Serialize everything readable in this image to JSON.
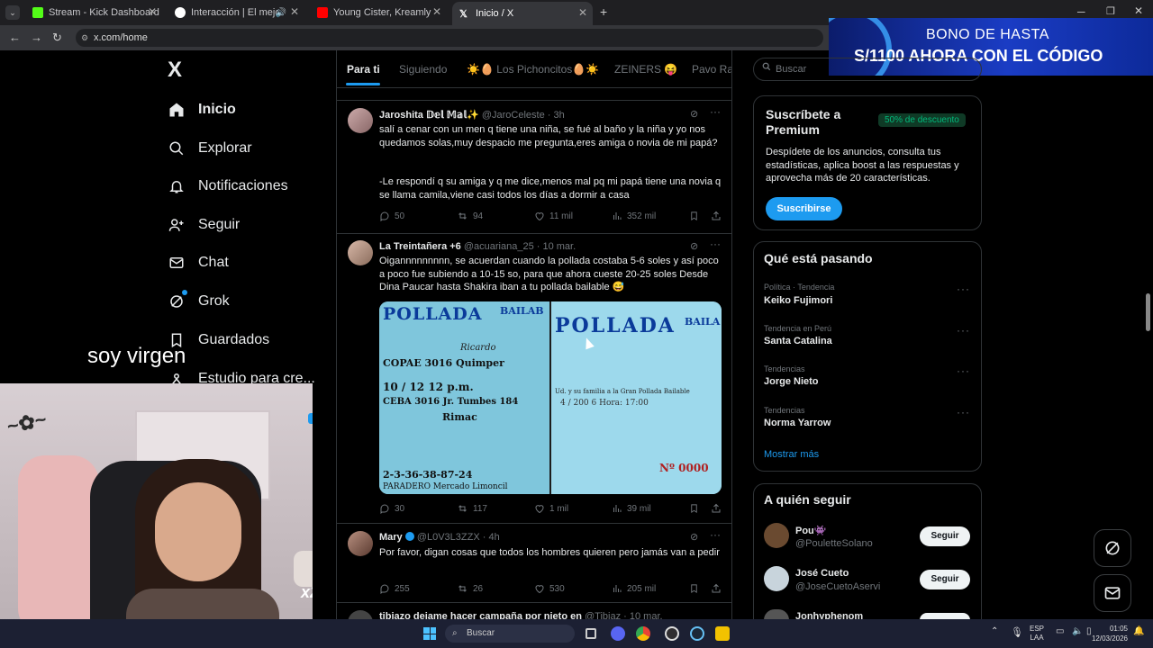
{
  "browser": {
    "tabs": [
      {
        "title": "Stream - Kick Dashboard",
        "color": "#53fc18"
      },
      {
        "title": "Interacción | El mejor softw",
        "color": "#ffffff"
      },
      {
        "title": "Young Cister, Kreamly - QLOO",
        "color": "#ff0000"
      },
      {
        "title": "Inicio / X",
        "color": "#ffffff"
      }
    ],
    "new_tab": "+",
    "url": "x.com/home"
  },
  "ad_banner": {
    "line1": "BONO DE HASTA",
    "line2": "S/1100 AHORA CON EL CÓDIGO"
  },
  "sidebar": {
    "logo": "X",
    "items": [
      {
        "label": "Inicio",
        "icon": "home-icon"
      },
      {
        "label": "Explorar",
        "icon": "search-icon"
      },
      {
        "label": "Notificaciones",
        "icon": "bell-icon"
      },
      {
        "label": "Seguir",
        "icon": "person-add-icon"
      },
      {
        "label": "Chat",
        "icon": "mail-icon"
      },
      {
        "label": "Grok",
        "icon": "grok-icon"
      },
      {
        "label": "Guardados",
        "icon": "bookmark-icon"
      },
      {
        "label": "Estudio para cre...",
        "icon": "studio-icon"
      }
    ]
  },
  "overlay": {
    "caption": "soy virgen",
    "badge": "x2"
  },
  "feed": {
    "tabs": [
      "Para ti",
      "Siguiendo",
      "☀️🥚 Los Pichoncitos🥚☀️",
      "ZEINERS 😝",
      "Pavo Ran"
    ],
    "posts": [
      {
        "name": "Jaroshita 𝔻𝕖𝕝 𝕄𝕒𝕝✨",
        "handle": "@JaroCeleste · 3h",
        "text1": "salí a cenar con un men q tiene una niña, se fué al baño y la niña y yo nos quedamos solas,muy despacio me pregunta,eres amiga o novia de mi papá?",
        "text2": "-Le respondí q su amiga y q me dice,menos mal pq mi papá tiene una novia q se llama camila,viene casi todos los días a dormir a casa",
        "replies": "50",
        "reposts": "94",
        "likes": "11 mil",
        "views": "352 mil"
      },
      {
        "name": "La Treintañera +6",
        "handle": "@acuariana_25 · 10 mar.",
        "text1": "Oigannnnnnnnn, se acuerdan cuando la pollada costaba 5-6 soles y así poco a poco fue subiendo a 10-15 so, para que ahora cueste 20-25 soles Desde Dina Paucar hasta Shakira iban a tu pollada bailable 😅",
        "ticket_left": {
          "header": "POLLADA",
          "sub": "BAILAB",
          "lines": [
            "Ricardo",
            "COPAE 3016 Quimper",
            "10 / 12   12 p.m.",
            "CEBA 3016  Jr. Tumbes 184",
            "Rimac",
            "2-3-36-38-87-24",
            "PARADERO  Mercado Limoncil"
          ]
        },
        "ticket_right": {
          "header": "POLLADA",
          "sub": "BAILA",
          "lines": [
            "Ud. y su familia a la Gran Pollada Bailable",
            "4 / 200 6   Hora: 17:00",
            "Nº 0000"
          ]
        },
        "replies": "30",
        "reposts": "117",
        "likes": "1 mil",
        "views": "39 mil"
      },
      {
        "name": "Mary",
        "handle": "@L0V3L3ZZX · 4h",
        "text1": "Por favor, digan cosas que todos los hombres quieren pero jamás van a pedir",
        "replies": "255",
        "reposts": "26",
        "likes": "530",
        "views": "205 mil"
      },
      {
        "name": "tibiazo dejame hacer campaña por nieto en",
        "handle": "@Tibiaz · 10 mar."
      }
    ]
  },
  "right": {
    "search_placeholder": "Buscar",
    "premium": {
      "title": "Suscríbete a Premium",
      "badge": "50% de descuento",
      "body": "Despídete de los anuncios, consulta tus estadísticas, aplica boost a las respuestas y aprovecha más de 20 características.",
      "button": "Suscribirse"
    },
    "trends": {
      "title": "Qué está pasando",
      "items": [
        {
          "meta": "Política · Tendencia",
          "name": "Keiko Fujimori"
        },
        {
          "meta": "Tendencia en Perú",
          "name": "Santa Catalina"
        },
        {
          "meta": "Tendencias",
          "name": "Jorge Nieto"
        },
        {
          "meta": "Tendencias",
          "name": "Norma Yarrow"
        }
      ],
      "show_more": "Mostrar más"
    },
    "follow": {
      "title": "A quién seguir",
      "items": [
        {
          "name": "Pou👾",
          "handle": "@PouletteSolano",
          "button": "Seguir"
        },
        {
          "name": "José Cueto",
          "handle": "@JoseCuetoAservi",
          "button": "Seguir"
        },
        {
          "name": "Jonhyphenom",
          "handle": "",
          "button": ""
        }
      ]
    }
  },
  "taskbar": {
    "search": "Buscar",
    "lang1": "ESP",
    "lang2": "LAA",
    "time": "01:05",
    "date": "12/03/2026"
  },
  "colors": {
    "accent": "#1d9bf0",
    "background": "#000000",
    "border": "#2f3336",
    "muted": "#71767b",
    "badge_green": "#00ba7c"
  }
}
